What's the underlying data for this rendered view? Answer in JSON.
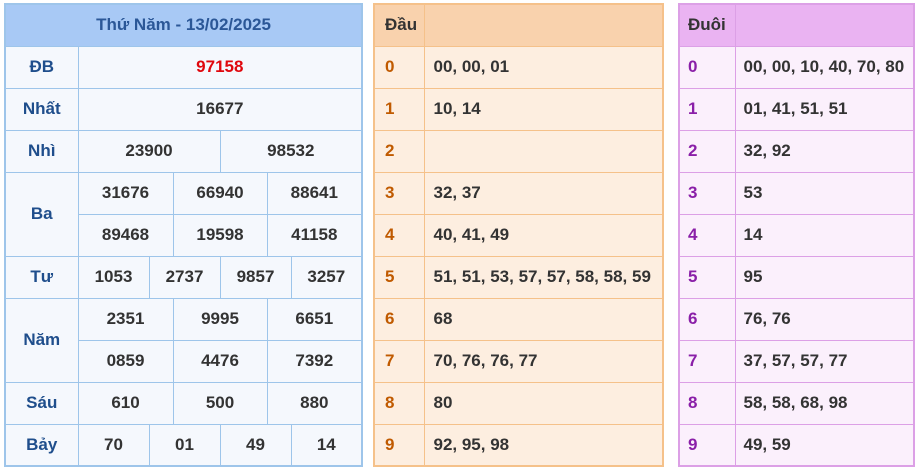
{
  "results": {
    "title": "Thứ Năm - 13/02/2025",
    "prizes": [
      {
        "label": "ĐB",
        "numbers": [
          "97158"
        ]
      },
      {
        "label": "Nhất",
        "numbers": [
          "16677"
        ]
      },
      {
        "label": "Nhì",
        "numbers": [
          "23900",
          "98532"
        ]
      },
      {
        "label": "Ba",
        "numbers": [
          "31676",
          "66940",
          "88641",
          "89468",
          "19598",
          "41158"
        ]
      },
      {
        "label": "Tư",
        "numbers": [
          "1053",
          "2737",
          "9857",
          "3257"
        ]
      },
      {
        "label": "Năm",
        "numbers": [
          "2351",
          "9995",
          "6651",
          "0859",
          "4476",
          "7392"
        ]
      },
      {
        "label": "Sáu",
        "numbers": [
          "610",
          "500",
          "880"
        ]
      },
      {
        "label": "Bảy",
        "numbers": [
          "70",
          "01",
          "49",
          "14"
        ]
      }
    ]
  },
  "dau": {
    "header": "Đầu",
    "rows": [
      {
        "key": "0",
        "values": "00, 00, 01"
      },
      {
        "key": "1",
        "values": "10, 14"
      },
      {
        "key": "2",
        "values": ""
      },
      {
        "key": "3",
        "values": "32, 37"
      },
      {
        "key": "4",
        "values": "40, 41, 49"
      },
      {
        "key": "5",
        "values": "51, 51, 53, 57, 57, 58, 58, 59"
      },
      {
        "key": "6",
        "values": "68"
      },
      {
        "key": "7",
        "values": "70, 76, 76, 77"
      },
      {
        "key": "8",
        "values": "80"
      },
      {
        "key": "9",
        "values": "92, 95, 98"
      }
    ]
  },
  "duoi": {
    "header": "Đuôi",
    "rows": [
      {
        "key": "0",
        "values": "00, 00, 10, 40, 70, 80"
      },
      {
        "key": "1",
        "values": "01, 41, 51, 51"
      },
      {
        "key": "2",
        "values": "32, 92"
      },
      {
        "key": "3",
        "values": "53"
      },
      {
        "key": "4",
        "values": "14"
      },
      {
        "key": "5",
        "values": "95"
      },
      {
        "key": "6",
        "values": "76, 76"
      },
      {
        "key": "7",
        "values": "37, 57, 57, 77"
      },
      {
        "key": "8",
        "values": "58, 58, 68, 98"
      },
      {
        "key": "9",
        "values": "49, 59"
      }
    ]
  },
  "colors": {
    "special_prize": "#e0070d",
    "results_header": "#a8c9f5",
    "dau_header": "#f9d2ad",
    "duoi_header": "#eab3f2"
  }
}
